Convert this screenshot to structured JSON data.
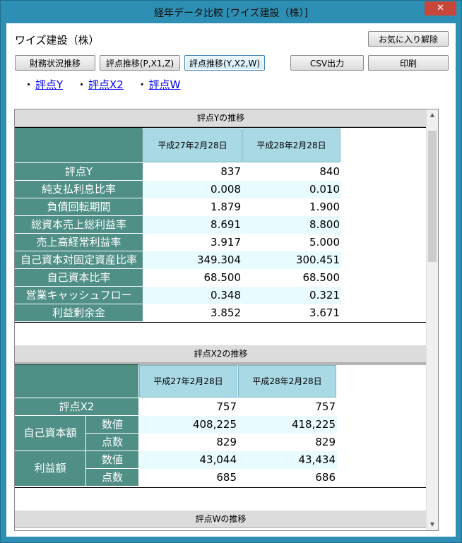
{
  "window": {
    "title": "経年データ比較 [ワイズ建設（株）]",
    "close_glyph": "✕"
  },
  "company_name": "ワイズ建設（株）",
  "buttons": {
    "favorite": "お気に入り解除",
    "financial": "財務状況推移",
    "score_pxz": "評点推移(P,X1,Z)",
    "score_yxw": "評点推移(Y,X2,W)",
    "csv": "CSV出力",
    "print": "印刷"
  },
  "links": [
    {
      "bullet": "・",
      "label": "評点Y"
    },
    {
      "bullet": "・",
      "label": "評点X2"
    },
    {
      "bullet": "・",
      "label": "評点W"
    }
  ],
  "section_y": {
    "title": "評点Yの推移",
    "periods": [
      "平成27年2月28日",
      "平成28年2月28日"
    ],
    "rows": [
      {
        "label": "評点Y",
        "v1": "837",
        "v2": "840"
      },
      {
        "label": "純支払利息比率",
        "v1": "0.008",
        "v2": "0.010"
      },
      {
        "label": "負債回転期間",
        "v1": "1.879",
        "v2": "1.900"
      },
      {
        "label": "総資本売上総利益率",
        "v1": "8.691",
        "v2": "8.800"
      },
      {
        "label": "売上高経常利益率",
        "v1": "3.917",
        "v2": "5.000"
      },
      {
        "label": "自己資本対固定資産比率",
        "v1": "349.304",
        "v2": "300.451"
      },
      {
        "label": "自己資本比率",
        "v1": "68.500",
        "v2": "68.500"
      },
      {
        "label": "営業キャッシュフロー",
        "v1": "0.348",
        "v2": "0.321"
      },
      {
        "label": "利益剰余金",
        "v1": "3.852",
        "v2": "3.671"
      }
    ]
  },
  "section_x2": {
    "title": "評点X2の推移",
    "periods": [
      "平成27年2月28日",
      "平成28年2月28日"
    ],
    "score_row": {
      "label": "評点X2",
      "v1": "757",
      "v2": "757"
    },
    "groups": [
      {
        "label": "自己資本額",
        "rows": [
          {
            "label": "数値",
            "v1": "408,225",
            "v2": "418,225"
          },
          {
            "label": "点数",
            "v1": "829",
            "v2": "829"
          }
        ]
      },
      {
        "label": "利益額",
        "rows": [
          {
            "label": "数値",
            "v1": "43,044",
            "v2": "43,434"
          },
          {
            "label": "点数",
            "v1": "685",
            "v2": "686"
          }
        ]
      }
    ]
  },
  "section_w": {
    "title": "評点Wの推移"
  },
  "scrollbar": {
    "up_glyph": "▲",
    "down_glyph": "▼"
  }
}
